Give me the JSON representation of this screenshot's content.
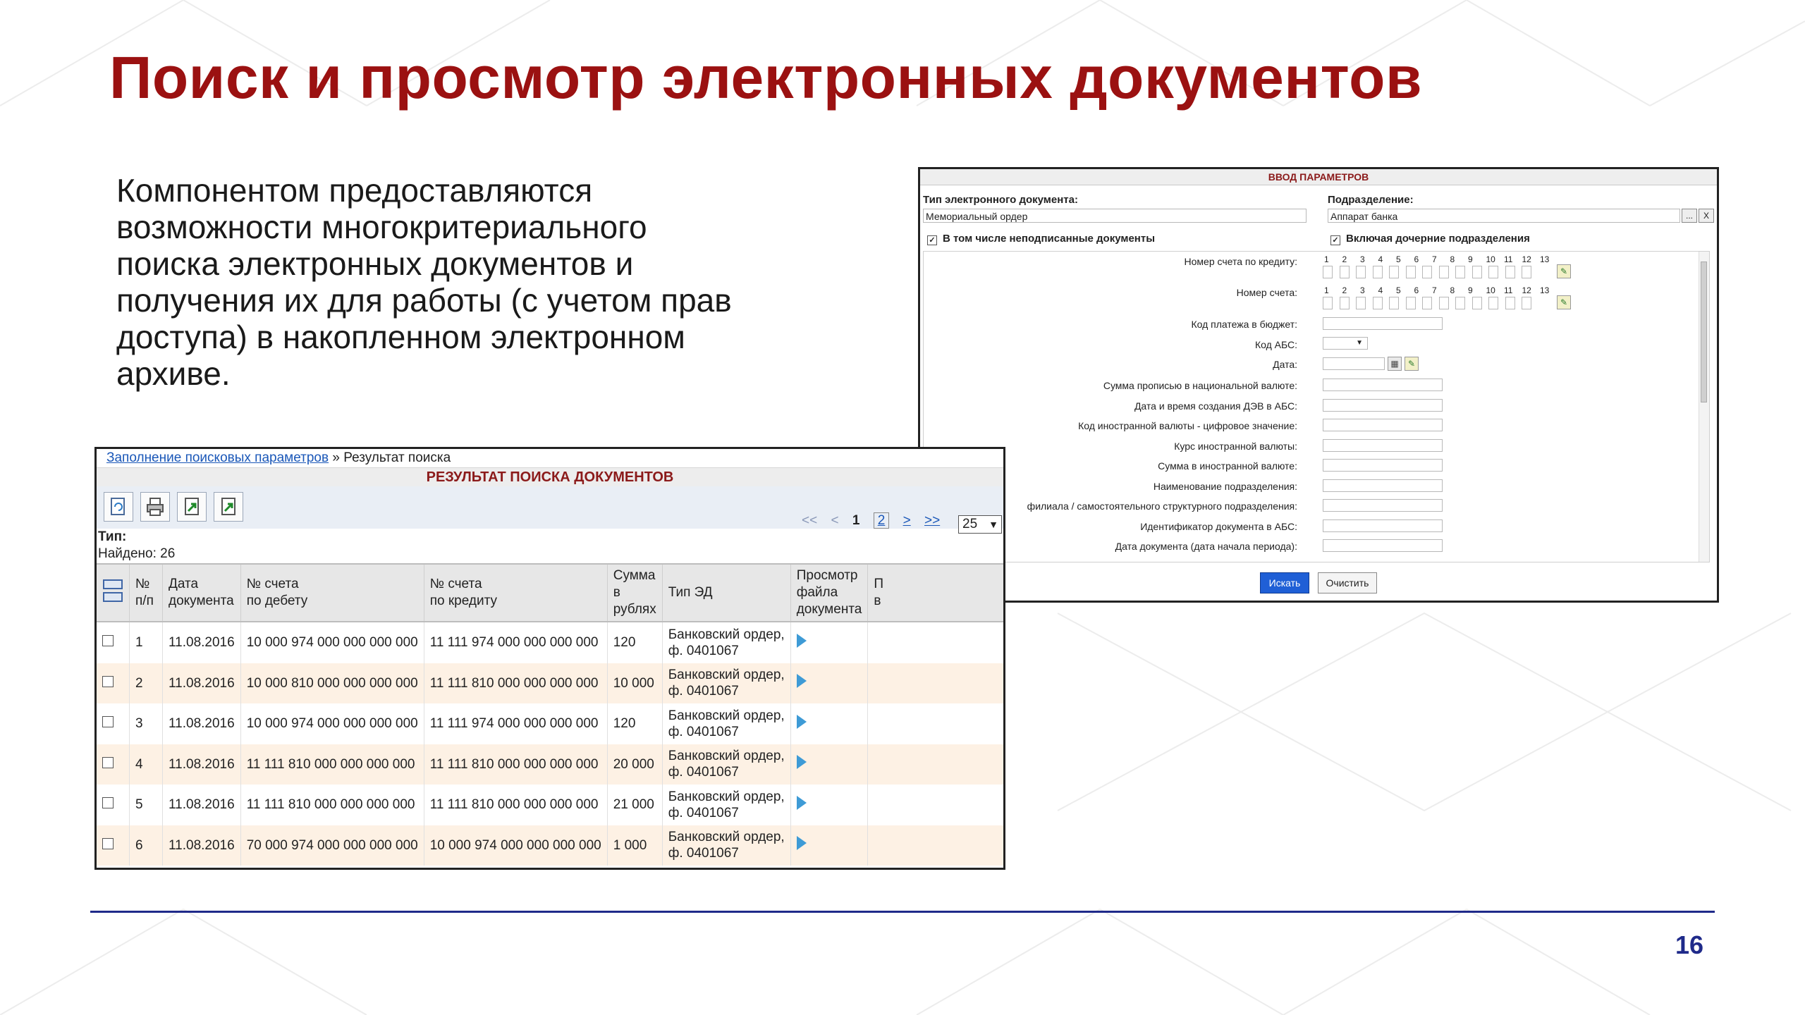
{
  "slide": {
    "title": "Поиск и просмотр электронных документов",
    "text": "Компонентом предоставляются возможности многокритериального поиска электронных документов и получения их для работы (с учетом прав доступа) в накопленном электронном архиве.",
    "page_number": "16"
  },
  "params": {
    "header": "ВВОД ПАРАМЕТРОВ",
    "doc_type_label": "Тип электронного документа:",
    "doc_type_value": "Мемориальный ордер",
    "division_label": "Подразделение:",
    "division_value": "Аппарат банка",
    "division_lookup": "...",
    "division_clear": "X",
    "unsigned_check": "В том числе неподписанные документы",
    "child_divisions_check": "Включая дочерние подразделения",
    "digits": [
      "1",
      "2",
      "3",
      "4",
      "5",
      "6",
      "7",
      "8",
      "9",
      "10",
      "11",
      "12",
      "13"
    ],
    "fields": [
      "Номер счета по кредиту:",
      "Номер счета:",
      "Код платежа в бюджет:",
      "Код АБС:",
      "Дата:",
      "Сумма прописью в национальной валюте:",
      "Дата и время создания ДЭВ в АБС:",
      "Код иностранной валюты - цифровое значение:",
      "Курс иностранной валюты:",
      "Сумма в иностранной валюте:",
      "Наименование подразделения:",
      "филиала / самостоятельного структурного подразделения:",
      "Идентификатор документа в АБС:",
      "Дата документа (дата начала периода):"
    ],
    "search_button": "Искать",
    "clear_button": "Очистить"
  },
  "results": {
    "breadcrumb_link": "Заполнение поисковых параметров",
    "breadcrumb_sep": "»",
    "breadcrumb_current": "Результат поиска",
    "title": "РЕЗУЛЬТАТ ПОИСКА ДОКУМЕНТОВ",
    "pager": {
      "first": "<<",
      "prev": "<",
      "current": "1",
      "page2": "2",
      "next": ">",
      "last": ">>"
    },
    "page_size": "25",
    "type_label": "Тип:",
    "found_label": "Найдено: 26",
    "columns": [
      "№\nп/п",
      "Дата\nдокумента",
      "№ счета\nпо дебету",
      "№ счета\nпо кредиту",
      "Сумма\nв рублях",
      "Тип ЭД",
      "Просмотр\nфайла\nдокумента",
      "П\nв"
    ],
    "rows": [
      {
        "n": "1",
        "date": "11.08.2016",
        "debit": "10 000 974 000 000 000 000",
        "credit": "11 111 974 000 000 000 000",
        "sum": "120",
        "type1": "Банковский ордер,",
        "type2": "ф. 0401067"
      },
      {
        "n": "2",
        "date": "11.08.2016",
        "debit": "10 000 810 000 000 000 000",
        "credit": "11 111 810 000 000 000 000",
        "sum": "10 000",
        "type1": "Банковский ордер,",
        "type2": "ф. 0401067"
      },
      {
        "n": "3",
        "date": "11.08.2016",
        "debit": "10 000 974 000 000 000 000",
        "credit": "11 111 974 000 000 000 000",
        "sum": "120",
        "type1": "Банковский ордер,",
        "type2": "ф. 0401067"
      },
      {
        "n": "4",
        "date": "11.08.2016",
        "debit": "11 111 810 000 000 000 000",
        "credit": "11 111 810 000 000 000 000",
        "sum": "20 000",
        "type1": "Банковский ордер,",
        "type2": "ф. 0401067"
      },
      {
        "n": "5",
        "date": "11.08.2016",
        "debit": "11 111 810 000 000 000 000",
        "credit": "11 111 810 000 000 000 000",
        "sum": "21 000",
        "type1": "Банковский ордер,",
        "type2": "ф. 0401067"
      },
      {
        "n": "6",
        "date": "11.08.2016",
        "debit": "70 000 974 000 000 000 000",
        "credit": "10 000 974 000 000 000 000",
        "sum": "1 000",
        "type1": "Банковский ордер,",
        "type2": "ф. 0401067"
      }
    ]
  },
  "colors": {
    "title": "#9b1111",
    "accent": "#1f2a8a",
    "link": "#1a57b8",
    "row_alt": "#fdf1e4"
  }
}
